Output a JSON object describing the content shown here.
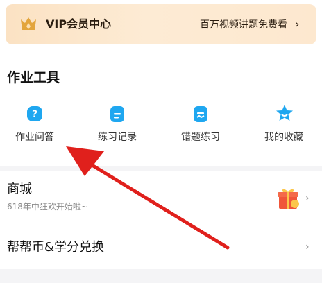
{
  "vip_banner": {
    "title": "VIP会员中心",
    "promo": "百万视频讲题免费看",
    "chevron": "›",
    "icon": "crown-icon"
  },
  "homework_tools": {
    "title": "作业工具",
    "items": [
      {
        "label": "作业问答",
        "icon": "question-icon"
      },
      {
        "label": "练习记录",
        "icon": "record-icon"
      },
      {
        "label": "错题练习",
        "icon": "wrong-question-icon"
      },
      {
        "label": "我的收藏",
        "icon": "star-icon"
      }
    ]
  },
  "shop": {
    "title": "商城",
    "subtitle": "618年中狂欢开始啦~",
    "icon": "gift-icon",
    "chevron": "›"
  },
  "exchange": {
    "title": "帮帮币&学分兑换",
    "chevron": "›"
  },
  "colors": {
    "accent_blue": "#1fa7f0",
    "vip_gold": "#e0a23a",
    "annotation_red": "#e0201c"
  }
}
